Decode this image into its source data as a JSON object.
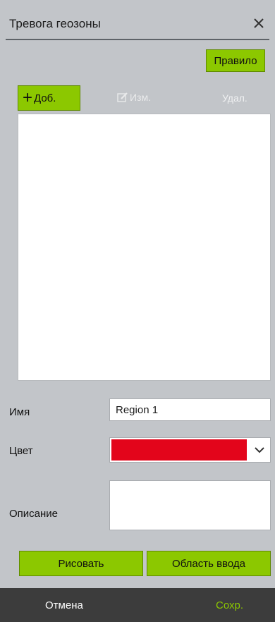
{
  "header": {
    "title": "Тревога геозоны"
  },
  "toolbar": {
    "rule_label": "Правило",
    "add_label": "Доб.",
    "edit_label": "Изм.",
    "delete_label": "Удал."
  },
  "form": {
    "name_label": "Имя",
    "name_value": "Region 1",
    "color_label": "Цвет",
    "color_value": "#e3051b",
    "description_label": "Описание",
    "description_value": ""
  },
  "actions": {
    "draw_label": "Рисовать",
    "area_label": "Область ввода"
  },
  "footer": {
    "cancel_label": "Отмена",
    "save_label": "Сохр."
  },
  "colors": {
    "accent": "#8cc800",
    "background": "#c2c5c9",
    "footer": "#3c3c3c"
  },
  "icons": {
    "close": "close-icon",
    "add": "plus-icon",
    "edit": "edit-icon",
    "dropdown": "chevron-down-icon"
  }
}
